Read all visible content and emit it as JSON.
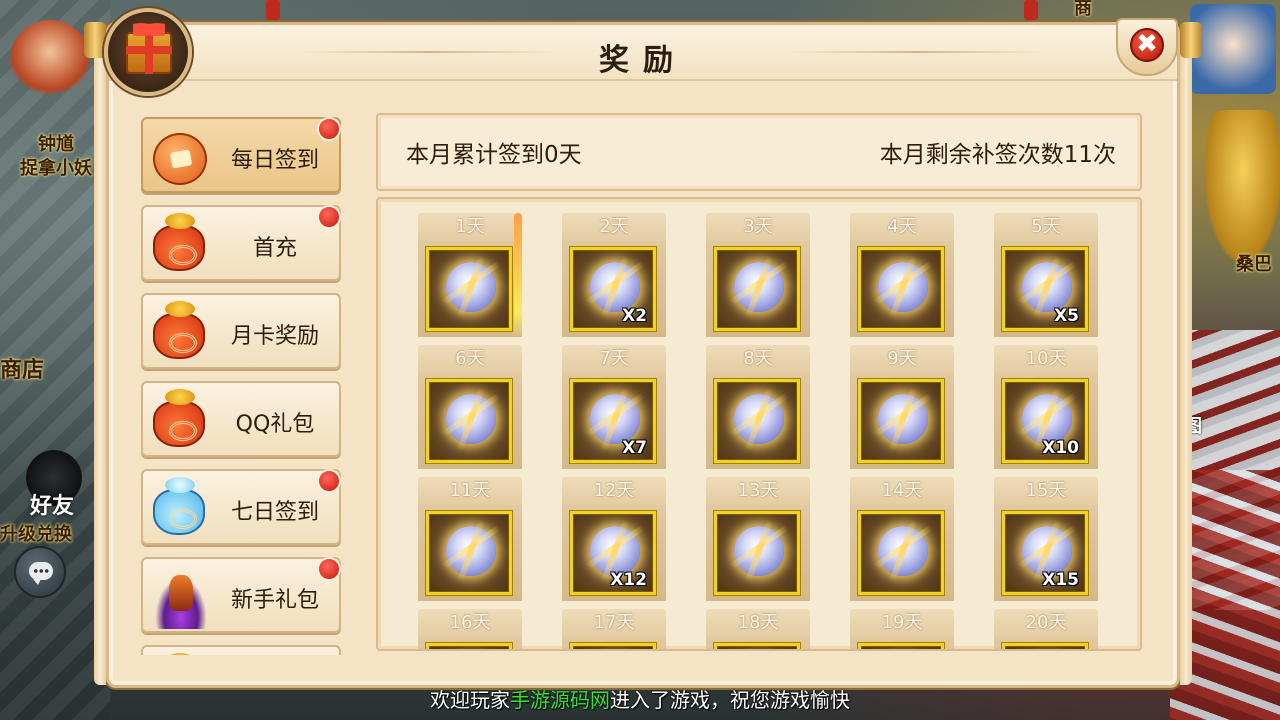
{
  "panel": {
    "title": "奖励",
    "close_label": "✖"
  },
  "background": {
    "labels": {
      "npc_name": "钟馗",
      "npc_task": "捉拿小妖",
      "shop": "商店",
      "friend": "好友",
      "upgrade": "升级兑换",
      "right_name": "桑巴",
      "right_map": "图",
      "top_partial": "商"
    }
  },
  "sidebar": {
    "items": [
      {
        "label": "每日签到",
        "icon": "red-envelope-icon",
        "badge": true,
        "active": true
      },
      {
        "label": "首充",
        "icon": "money-bag-icon",
        "badge": true,
        "active": false
      },
      {
        "label": "月卡奖励",
        "icon": "money-bag-icon",
        "badge": false,
        "active": false
      },
      {
        "label": "QQ礼包",
        "icon": "money-bag-icon",
        "badge": false,
        "active": false
      },
      {
        "label": "七日签到",
        "icon": "blue-bag-icon",
        "badge": true,
        "active": false
      },
      {
        "label": "新手礼包",
        "icon": "crystal-icon",
        "badge": true,
        "active": false
      },
      {
        "label": "",
        "icon": "money-bag-icon",
        "badge": false,
        "active": false
      }
    ]
  },
  "info": {
    "monthly_count": "本月累计签到0天",
    "remaining_resign": "本月剩余补签次数11次"
  },
  "days": [
    {
      "label": "1天",
      "qty": "",
      "highlight": true
    },
    {
      "label": "2天",
      "qty": "X2"
    },
    {
      "label": "3天",
      "qty": ""
    },
    {
      "label": "4天",
      "qty": ""
    },
    {
      "label": "5天",
      "qty": "X5"
    },
    {
      "label": "6天",
      "qty": ""
    },
    {
      "label": "7天",
      "qty": "X7"
    },
    {
      "label": "8天",
      "qty": ""
    },
    {
      "label": "9天",
      "qty": ""
    },
    {
      "label": "10天",
      "qty": "X10"
    },
    {
      "label": "11天",
      "qty": ""
    },
    {
      "label": "12天",
      "qty": "X12"
    },
    {
      "label": "13天",
      "qty": ""
    },
    {
      "label": "14天",
      "qty": ""
    },
    {
      "label": "15天",
      "qty": "X15"
    },
    {
      "label": "16天",
      "qty": ""
    },
    {
      "label": "17天",
      "qty": ""
    },
    {
      "label": "18天",
      "qty": ""
    },
    {
      "label": "19天",
      "qty": ""
    },
    {
      "label": "20天",
      "qty": ""
    }
  ],
  "system_message": {
    "prefix": "欢迎玩家",
    "player": "手游源码网",
    "suffix": "进入了游戏，祝您游戏愉快"
  },
  "colors": {
    "accent_gold": "#f3d321",
    "badge_red": "#c8140a",
    "highlight_green": "#35e23a"
  }
}
